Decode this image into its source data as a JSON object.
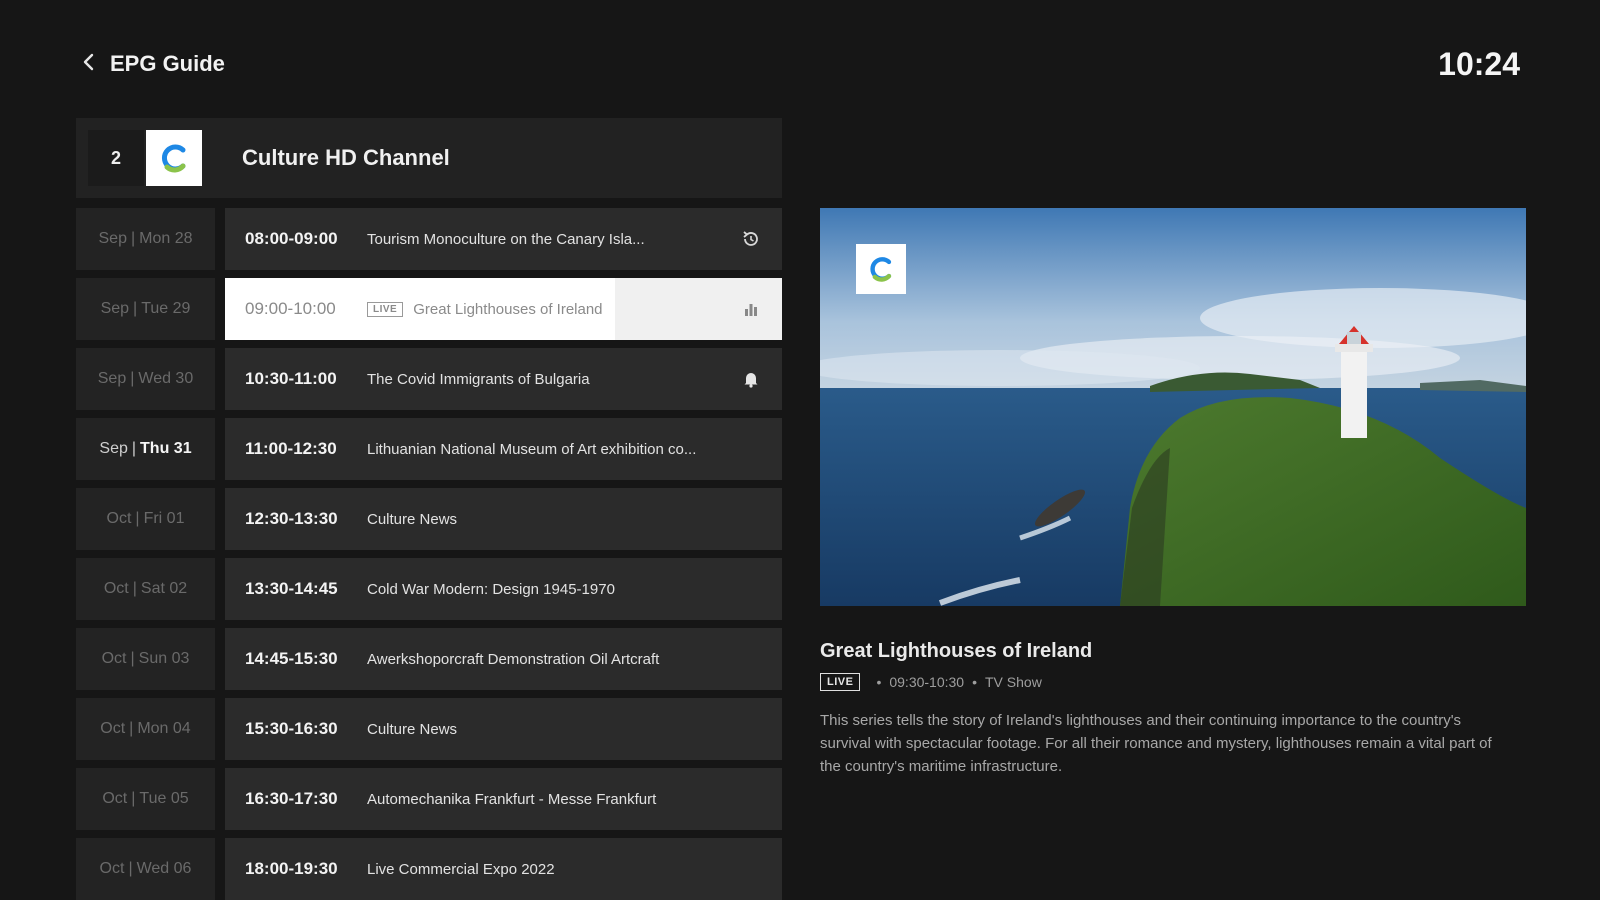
{
  "header": {
    "back_label": "EPG Guide",
    "clock": "10:24"
  },
  "channel": {
    "number": "2",
    "name": "Culture HD Channel",
    "logo_icon": "channel-c-logo"
  },
  "guide": {
    "rows": [
      {
        "month": "Sep",
        "day": "Mon 28",
        "time": "08:00-09:00",
        "title": "Tourism Monoculture on the Canary Isla...",
        "icon": "replay-icon"
      },
      {
        "month": "Sep",
        "day": "Tue 29",
        "time": "09:00-10:00",
        "title": "Great Lighthouses of Ireland",
        "icon": "equalizer-icon",
        "live": "LIVE",
        "progress": 0.7
      },
      {
        "month": "Sep",
        "day": "Wed 30",
        "time": "10:30-11:00",
        "title": "The Covid Immigrants of Bulgaria",
        "icon": "bell-icon"
      },
      {
        "month": "Sep",
        "day": "Thu 31",
        "time": "11:00-12:30",
        "title": "Lithuanian National Museum of Art exhibition co..."
      },
      {
        "month": "Oct",
        "day": "Fri 01",
        "time": "12:30-13:30",
        "title": "Culture News"
      },
      {
        "month": "Oct",
        "day": "Sat 02",
        "time": "13:30-14:45",
        "title": "Cold War Modern: Design 1945-1970"
      },
      {
        "month": "Oct",
        "day": "Sun 03",
        "time": "14:45-15:30",
        "title": "Awerkshoporcraft Demonstration Oil Artcraft"
      },
      {
        "month": "Oct",
        "day": "Mon 04",
        "time": "15:30-16:30",
        "title": "Culture News"
      },
      {
        "month": "Oct",
        "day": "Tue 05",
        "time": "16:30-17:30",
        "title": "Automechanika Frankfurt - Messe Frankfurt"
      },
      {
        "month": "Oct",
        "day": "Wed 06",
        "time": "18:00-19:30",
        "title": "Live Commercial Expo 2022"
      }
    ]
  },
  "details": {
    "title": "Great Lighthouses of Ireland",
    "live": "LIVE",
    "time": "09:30-10:30",
    "type": "TV Show",
    "description": "This series tells the story of Ireland's lighthouses and their continuing importance to the country's survival with spectacular footage. For all their romance and mystery, lighthouses remain a vital part of the country's maritime infrastructure."
  },
  "colors": {
    "background": "#161616",
    "row": "#2b2b2b",
    "selected": "#f0f0f0",
    "logo_blue": "#1e88e5",
    "logo_green": "#8bc34a"
  }
}
